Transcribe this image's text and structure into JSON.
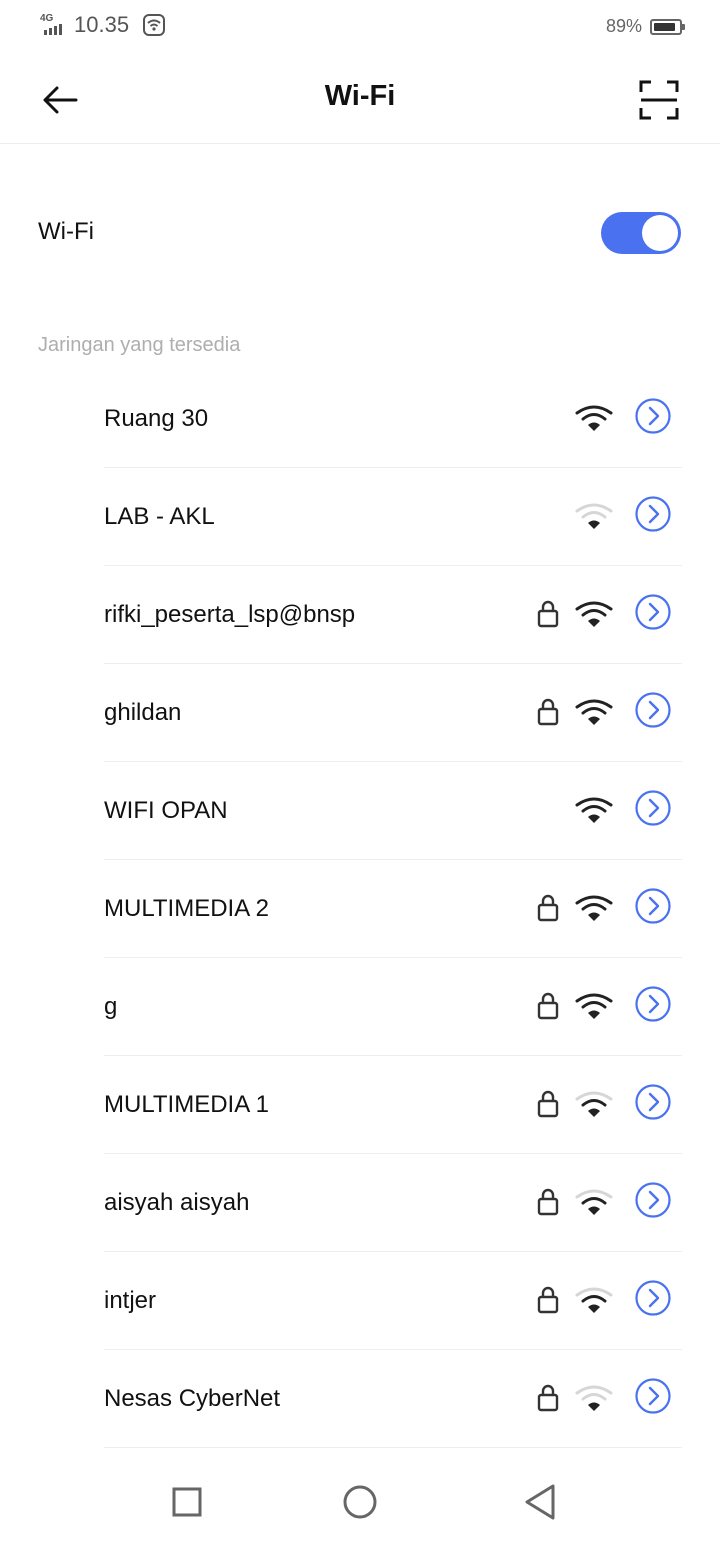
{
  "status_bar": {
    "network": "4G",
    "time": "10.35",
    "battery_text": "89%",
    "battery_level": 0.89
  },
  "header": {
    "title": "Wi-Fi",
    "back_icon": "arrow-left-icon",
    "scan_icon": "scan-frame-icon"
  },
  "wifi_toggle": {
    "label": "Wi-Fi",
    "on": true,
    "accent": "#4a72f0"
  },
  "available_section": {
    "title": "Jaringan yang tersedia"
  },
  "networks": [
    {
      "name": "Ruang 30",
      "locked": false,
      "signal": "strong"
    },
    {
      "name": "LAB - AKL",
      "locked": false,
      "signal": "weak"
    },
    {
      "name": "rifki_peserta_lsp@bnsp",
      "locked": true,
      "signal": "strong"
    },
    {
      "name": "ghildan",
      "locked": true,
      "signal": "strong"
    },
    {
      "name": "WIFI OPAN",
      "locked": false,
      "signal": "strong"
    },
    {
      "name": "MULTIMEDIA 2",
      "locked": true,
      "signal": "strong"
    },
    {
      "name": "g",
      "locked": true,
      "signal": "strong"
    },
    {
      "name": "MULTIMEDIA 1",
      "locked": true,
      "signal": "medium"
    },
    {
      "name": "aisyah aisyah",
      "locked": true,
      "signal": "medium"
    },
    {
      "name": "intjer",
      "locked": true,
      "signal": "medium"
    },
    {
      "name": "Nesas CyberNet",
      "locked": true,
      "signal": "weak"
    }
  ],
  "nav_bar": {
    "recent_icon": "square-icon",
    "home_icon": "circle-icon",
    "back_icon": "triangle-back-icon"
  },
  "colors": {
    "accent": "#4a72f0",
    "signal_strong": "#222222",
    "signal_faded": "#d6d6d6"
  }
}
